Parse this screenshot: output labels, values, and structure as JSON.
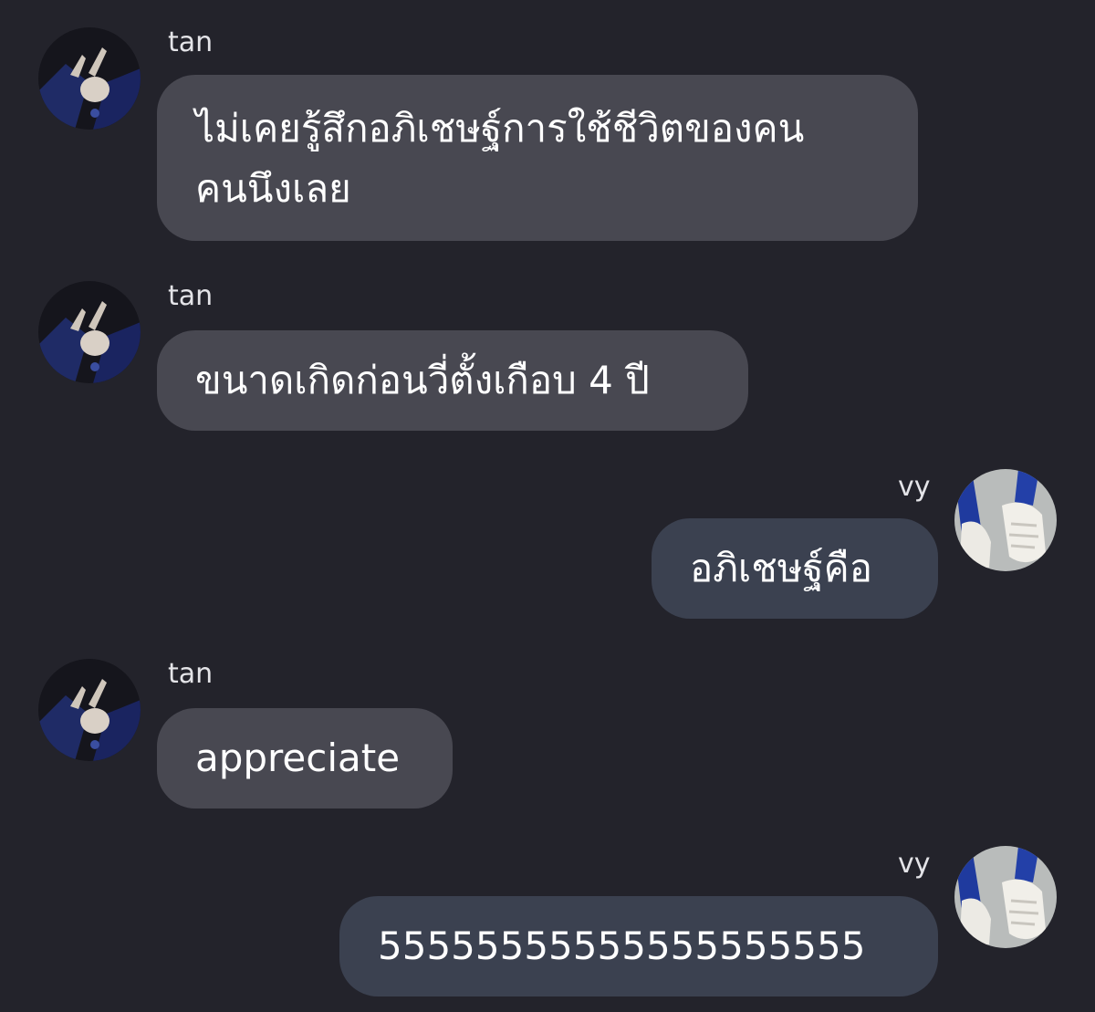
{
  "chat": {
    "messages": [
      {
        "sender": "tan",
        "direction": "incoming",
        "avatar": "avatar-tan-peace-sign",
        "lines": [
          "ไม่เคยรู้สึกอภิเชษฐ์การใช้ชีวิตของคน",
          "คนนึงเลย"
        ]
      },
      {
        "sender": "tan",
        "direction": "incoming",
        "avatar": "avatar-tan-peace-sign",
        "lines": [
          "ขนาดเกิดก่อนวี่ตั้งเกือบ 4 ปี"
        ]
      },
      {
        "sender": "vy",
        "direction": "outgoing",
        "avatar": "avatar-vy-sneakers",
        "lines": [
          "อภิเชษฐ์คือ"
        ]
      },
      {
        "sender": "tan",
        "direction": "incoming",
        "avatar": "avatar-tan-peace-sign",
        "lines": [
          "appreciate"
        ]
      },
      {
        "sender": "vy",
        "direction": "outgoing",
        "avatar": "avatar-vy-sneakers",
        "lines": [
          "55555555555555555555"
        ]
      }
    ]
  },
  "colors": {
    "background": "#23232b",
    "incoming_bubble": "#484851",
    "outgoing_bubble": "#3b4150",
    "text": "#ffffff",
    "sender_name": "#e4e4e8"
  }
}
